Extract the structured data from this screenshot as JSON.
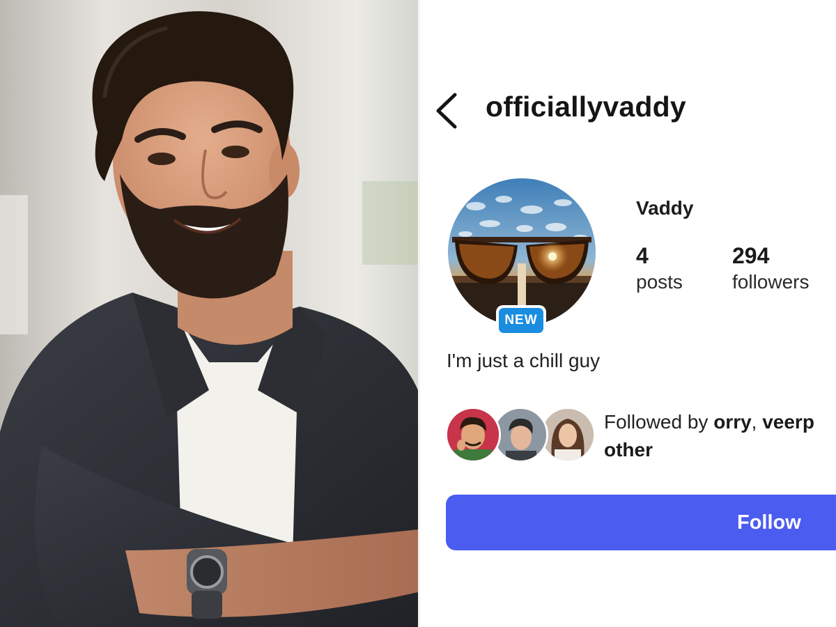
{
  "profile": {
    "username": "officiallyvaddy",
    "display_name": "Vaddy",
    "badge": "NEW",
    "stats": [
      {
        "value": "4",
        "label": "posts"
      },
      {
        "value": "294",
        "label": "followers"
      }
    ],
    "bio": "I'm just a chill guy",
    "followed_by": {
      "prefix": "Followed by ",
      "user1": "orry",
      "separator": ", ",
      "user2": "veerp",
      "line2": "other"
    },
    "follow_label": "Follow"
  },
  "icons": {
    "back": "chevron-left-icon"
  },
  "colors": {
    "follow_button": "#4b5cf0",
    "new_badge": "#1a8de0"
  }
}
